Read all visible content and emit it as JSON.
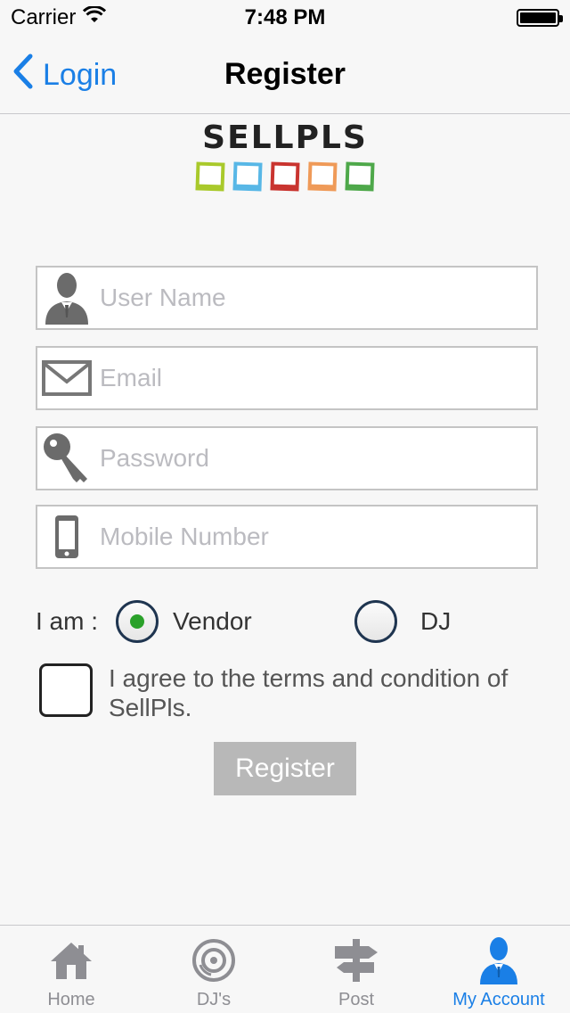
{
  "status_bar": {
    "carrier": "Carrier",
    "time": "7:48 PM"
  },
  "nav": {
    "back_label": "Login",
    "title": "Register"
  },
  "logo": {
    "text": "SELLPLS",
    "frame_colors": [
      "#a9c92b",
      "#58b7e6",
      "#c9342f",
      "#ef9a58",
      "#4ea84a"
    ]
  },
  "form": {
    "username": {
      "placeholder": "User Name",
      "value": ""
    },
    "email": {
      "placeholder": "Email",
      "value": ""
    },
    "password": {
      "placeholder": "Password",
      "value": ""
    },
    "mobile": {
      "placeholder": "Mobile Number",
      "value": ""
    }
  },
  "role": {
    "label": "I am :",
    "options": [
      {
        "label": "Vendor",
        "selected": true
      },
      {
        "label": "DJ",
        "selected": false
      }
    ]
  },
  "terms": {
    "text": "I agree to the terms and condition of SellPls.",
    "checked": false
  },
  "register_button": "Register",
  "tab_bar": {
    "tabs": [
      {
        "label": "Home",
        "icon": "home-icon",
        "active": false
      },
      {
        "label": "DJ's",
        "icon": "disc-icon",
        "active": false
      },
      {
        "label": "Post",
        "icon": "signpost-icon",
        "active": false
      },
      {
        "label": "My Account",
        "icon": "user-icon",
        "active": true
      }
    ]
  },
  "colors": {
    "accent": "#1a7fe6",
    "radio_selected": "#2aa12a",
    "button_disabled": "#b8b8b8"
  }
}
